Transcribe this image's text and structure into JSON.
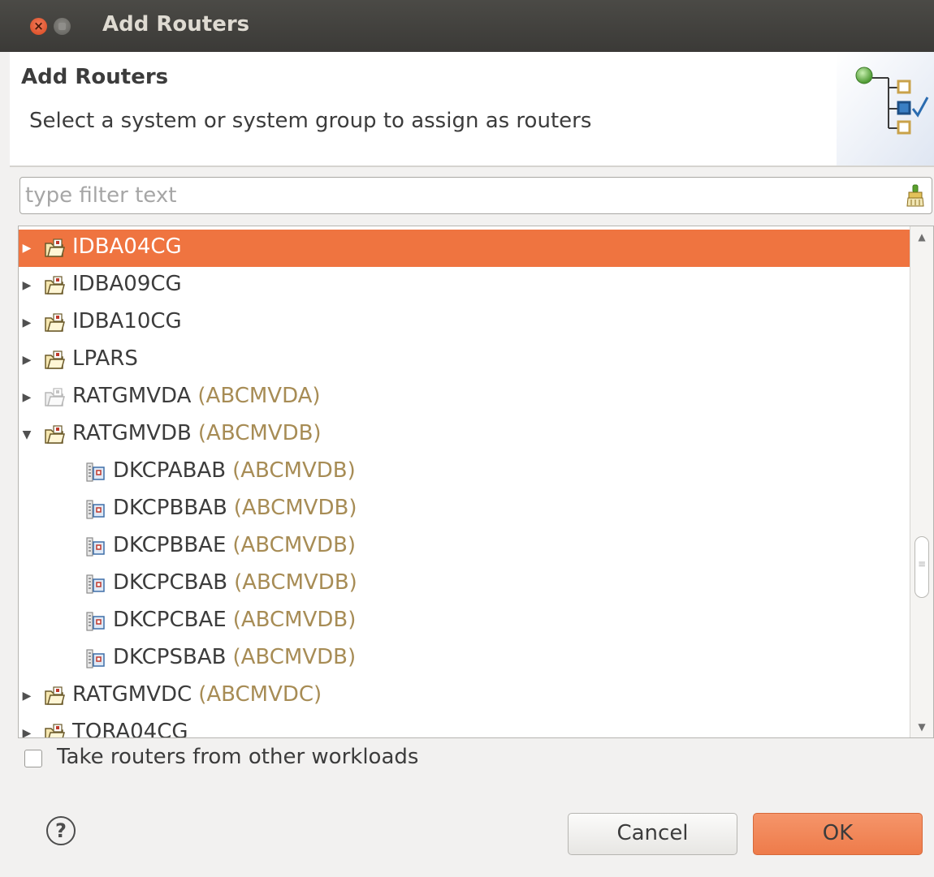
{
  "window": {
    "title": "Add Routers"
  },
  "header": {
    "title": "Add Routers",
    "description": "Select a system or system group to assign as routers",
    "icon": "wizard-tree-check-icon"
  },
  "filter": {
    "placeholder": "type filter text",
    "value": "",
    "clear_icon": "clear-filter-icon"
  },
  "tree": {
    "items": [
      {
        "label": "IDBA04CG",
        "sub": "",
        "level": 0,
        "expander": "collapsed",
        "icon": "system-group-icon",
        "selected": true
      },
      {
        "label": "IDBA09CG",
        "sub": "",
        "level": 0,
        "expander": "collapsed",
        "icon": "system-group-icon",
        "selected": false
      },
      {
        "label": "IDBA10CG",
        "sub": "",
        "level": 0,
        "expander": "collapsed",
        "icon": "system-group-icon",
        "selected": false
      },
      {
        "label": "LPARS",
        "sub": "",
        "level": 0,
        "expander": "collapsed",
        "icon": "system-group-icon",
        "selected": false
      },
      {
        "label": "RATGMVDA",
        "sub": "(ABCMVDA)",
        "level": 0,
        "expander": "collapsed",
        "icon": "system-group-disabled-icon",
        "selected": false
      },
      {
        "label": "RATGMVDB",
        "sub": "(ABCMVDB)",
        "level": 0,
        "expander": "expanded",
        "icon": "system-group-icon",
        "selected": false
      },
      {
        "label": "DKCPABAB",
        "sub": "(ABCMVDB)",
        "level": 1,
        "expander": "none",
        "icon": "system-icon",
        "selected": false
      },
      {
        "label": "DKCPBBAB",
        "sub": "(ABCMVDB)",
        "level": 1,
        "expander": "none",
        "icon": "system-icon",
        "selected": false
      },
      {
        "label": "DKCPBBAE",
        "sub": "(ABCMVDB)",
        "level": 1,
        "expander": "none",
        "icon": "system-icon",
        "selected": false
      },
      {
        "label": "DKCPCBAB",
        "sub": "(ABCMVDB)",
        "level": 1,
        "expander": "none",
        "icon": "system-icon",
        "selected": false
      },
      {
        "label": "DKCPCBAE",
        "sub": "(ABCMVDB)",
        "level": 1,
        "expander": "none",
        "icon": "system-icon",
        "selected": false
      },
      {
        "label": "DKCPSBAB",
        "sub": "(ABCMVDB)",
        "level": 1,
        "expander": "none",
        "icon": "system-icon",
        "selected": false
      },
      {
        "label": "RATGMVDC",
        "sub": "(ABCMVDC)",
        "level": 0,
        "expander": "collapsed",
        "icon": "system-group-icon",
        "selected": false
      },
      {
        "label": "TORA04CG",
        "sub": "",
        "level": 0,
        "expander": "collapsed",
        "icon": "system-group-icon",
        "selected": false
      }
    ]
  },
  "options": {
    "take_routers_label": "Take routers from other workloads",
    "take_routers_checked": false
  },
  "footer": {
    "help_label": "?",
    "cancel_label": "Cancel",
    "ok_label": "OK"
  },
  "colors": {
    "accent": "#ef7440",
    "secondary_text": "#a78c55",
    "titlebar": "#3b3a37"
  }
}
